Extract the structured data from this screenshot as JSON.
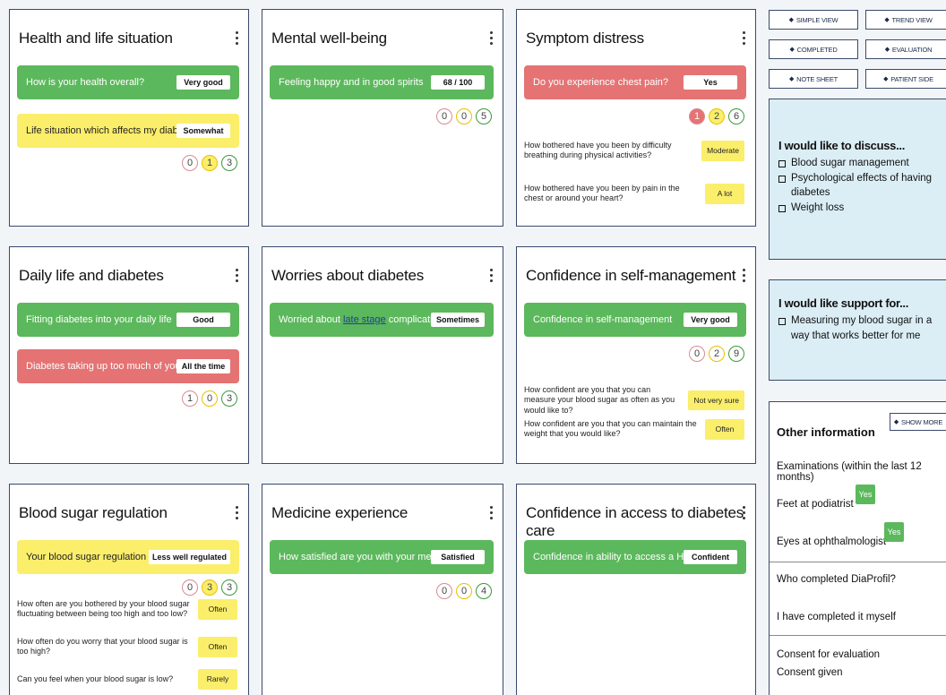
{
  "cards": {
    "health": {
      "title": "Health and life situation",
      "q1": "How is your health overall?",
      "a1": "Very good",
      "q2": "Life situation which affects my diabetes",
      "a2": "Somewhat",
      "c": [
        "0",
        "1",
        "3"
      ]
    },
    "mental": {
      "title": "Mental well-being",
      "q1": "Feeling happy and in good spirits",
      "a1": "68 / 100",
      "c": [
        "0",
        "0",
        "5"
      ]
    },
    "symptom": {
      "title": "Symptom distress",
      "q1": "Do you experience chest pain?",
      "a1": "Yes",
      "c": [
        "1",
        "2",
        "6"
      ],
      "s1q": "How bothered have you been by difficulty breathing during physical activities?",
      "s1a": "Moderate",
      "s2q": "How bothered have you been by pain in the chest or around your heart?",
      "s2a": "A lot"
    },
    "daily": {
      "title": "Daily life and diabetes",
      "q1": "Fitting diabetes into your daily life",
      "a1": "Good",
      "q2": "Diabetes taking up too much of your life?",
      "a2": "All the time",
      "c": [
        "1",
        "0",
        "3"
      ]
    },
    "worries": {
      "title": "Worries about diabetes",
      "q1_pre": "Worried about ",
      "q1_link": "late stage",
      "q1_post": " complications?",
      "a1": "Sometimes"
    },
    "confidence": {
      "title": "Confidence in self-management",
      "q1": "Confidence in self-management",
      "a1": "Very good",
      "c": [
        "0",
        "2",
        "9"
      ],
      "s1q": "How confident are you that you can measure your blood sugar as often as you would like to?",
      "s1a": "Not very sure",
      "s2q": "How confident are you that you can maintain the weight that you would like?",
      "s2a": "Often"
    },
    "blood": {
      "title": "Blood sugar regulation",
      "q1": "Your blood sugar regulation past month?",
      "a1": "Less well regulated",
      "c": [
        "0",
        "3",
        "3"
      ],
      "s1q": "How often are you bothered by your blood sugar fluctuating between being too high and too low?",
      "s1a": "Often",
      "s2q": "How often do you worry that your blood sugar is too high?",
      "s2a": "Often",
      "s3q": "Can you feel when your blood sugar is low?",
      "s3a": "Rarely"
    },
    "medicine": {
      "title": "Medicine experience",
      "q1": "How satisfied are you with your medication?",
      "a1": "Satisfied",
      "c": [
        "0",
        "0",
        "4"
      ]
    },
    "access": {
      "title": "Confidence in access to diabetes care",
      "q1": "Confidence in ability to access a HCP",
      "a1": "Confident"
    }
  },
  "buttons": {
    "simple_view": "SIMPLE VIEW",
    "trend_view": "TREND VIEW",
    "completed": "COMPLETED",
    "evaluation": "EVALUATION",
    "note_sheet": "NOTE SHEET",
    "patient_side": "PATIENT SIDE",
    "show_more": "SHOW MORE"
  },
  "discuss": {
    "title": "I would like to discuss...",
    "items": [
      "Blood sugar management",
      "Psychological effects of having diabetes",
      "Weight loss"
    ]
  },
  "support": {
    "title": "I would like support for...",
    "items": [
      "Measuring my blood sugar in a way that works better for me"
    ]
  },
  "other": {
    "title": "Other information",
    "exam_heading": "Examinations (within the last 12 months)",
    "feet_label": "Feet at podiatrist",
    "feet_value": "Yes",
    "eyes_label": "Eyes at ophthalmologist",
    "eyes_value": "Yes",
    "who_heading": "Who completed DiaProfil?",
    "who_value": "I have completed it myself",
    "consent_heading": "Consent for evaluation",
    "consent_value": "Consent given"
  }
}
